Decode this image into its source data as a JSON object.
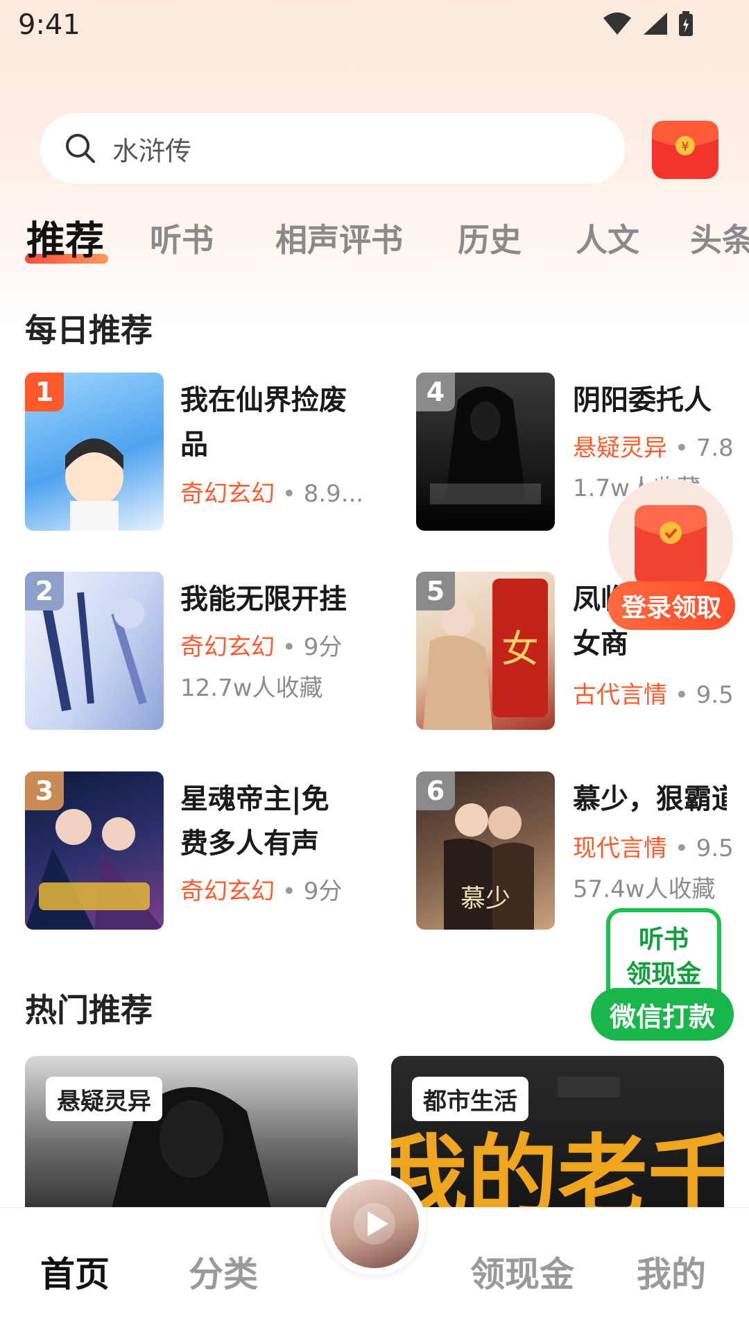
{
  "status": {
    "time": "9:41"
  },
  "search": {
    "placeholder": "水浒传"
  },
  "tabs": [
    "推荐",
    "听书",
    "相声评书",
    "历史",
    "人文",
    "头条"
  ],
  "daily": {
    "title": "每日推荐",
    "books": [
      {
        "rank": "1",
        "title": "我在仙界捡废品",
        "category": "奇幻玄幻",
        "score": "8.9...",
        "favs": ""
      },
      {
        "rank": "2",
        "title": "我能无限开挂",
        "category": "奇幻玄幻",
        "score": "9分",
        "favs": "12.7w人收藏"
      },
      {
        "rank": "3",
        "title": "星魂帝主|免费多人有声",
        "category": "奇幻玄幻",
        "score": "9分",
        "favs": ""
      },
      {
        "rank": "4",
        "title": "阴阳委托人",
        "category": "悬疑灵异",
        "score": "7.8",
        "favs": "1.7w人收藏"
      },
      {
        "rank": "5",
        "title": "凤临天下：女商",
        "category": "古代言情",
        "score": "9.5",
        "favs": ""
      },
      {
        "rank": "6",
        "title": "慕少，狠霸道",
        "category": "现代言情",
        "score": "9.5",
        "favs": "57.4w人收藏"
      }
    ],
    "dot": "•"
  },
  "float": {
    "redpack_label": "登录领取",
    "listen_line1": "听书",
    "listen_line2": "领现金",
    "wechat": "微信打款"
  },
  "hot": {
    "title": "热门推荐",
    "cards": [
      {
        "tag": "悬疑灵异"
      },
      {
        "tag": "都市生活"
      }
    ]
  },
  "nav": {
    "home": "首页",
    "category": "分类",
    "cash": "领现金",
    "mine": "我的"
  },
  "colors": {
    "accent": "#ff5a2c",
    "green": "#19b64b"
  }
}
